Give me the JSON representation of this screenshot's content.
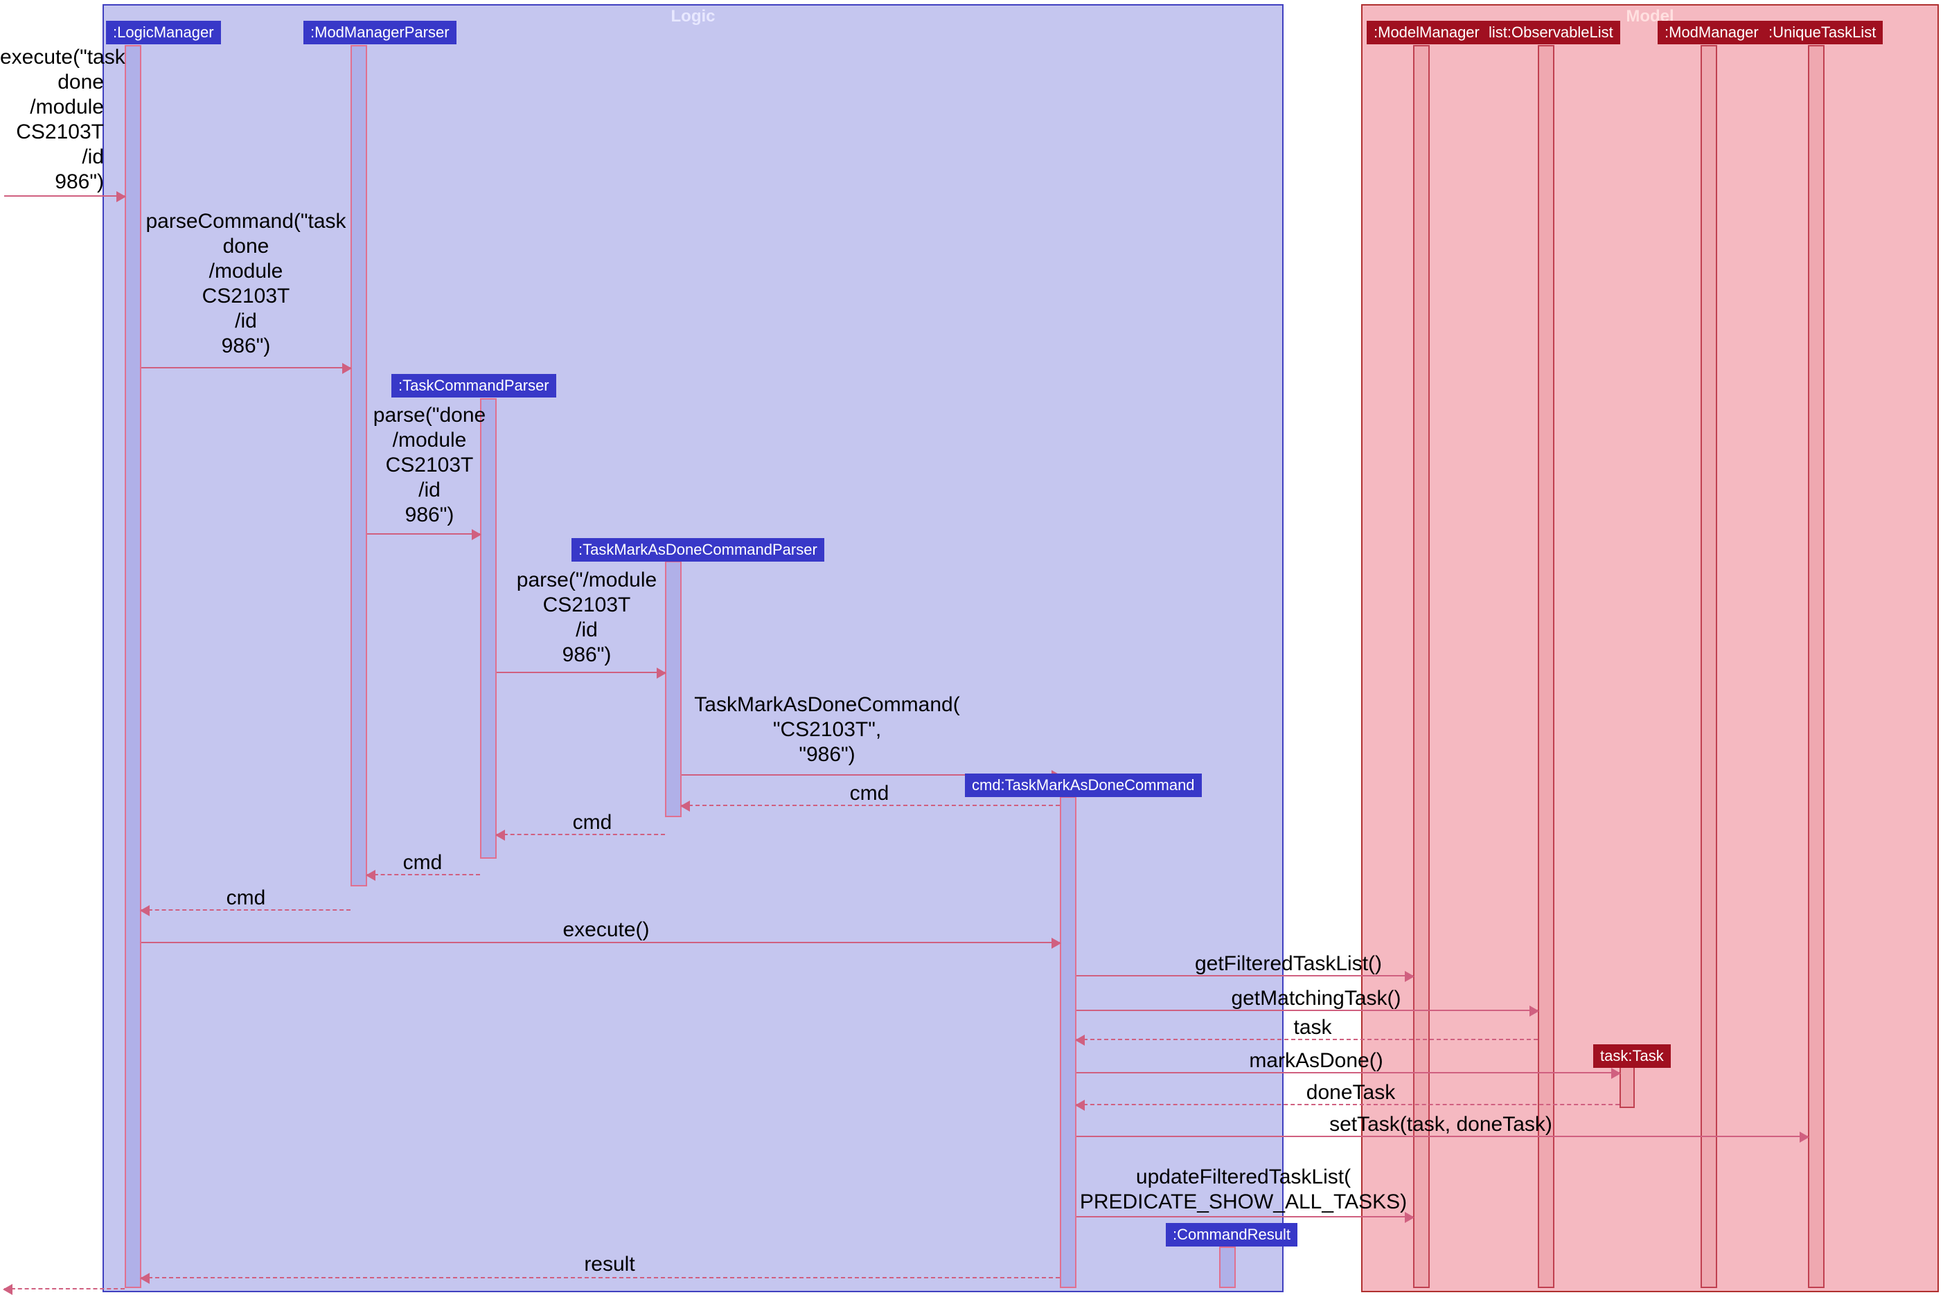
{
  "frames": {
    "logic": {
      "title": "Logic"
    },
    "model": {
      "title": "Model"
    }
  },
  "participants": {
    "logicManager": ":LogicManager",
    "modManagerParser": ":ModManagerParser",
    "taskCommandParser": ":TaskCommandParser",
    "taskMarkAsDoneCommandParser": ":TaskMarkAsDoneCommandParser",
    "cmdTaskMarkAsDoneCommand": "cmd:TaskMarkAsDoneCommand",
    "commandResult": ":CommandResult",
    "modelManager": ":ModelManager",
    "listObservableList": "list:ObservableList",
    "modManagerModel": ":ModManager",
    "uniqueTaskList": ":UniqueTaskList",
    "taskTask": "task:Task"
  },
  "messages": {
    "execute1": "execute(\"task\ndone\n/module\nCS2103T\n/id\n986\")",
    "parseCommand": "parseCommand(\"task\ndone\n/module\nCS2103T\n/id\n986\")",
    "parse1": "parse(\"done\n/module\nCS2103T\n/id\n986\")",
    "parse2": "parse(\"/module\nCS2103T\n/id\n986\")",
    "newCmd": "TaskMarkAsDoneCommand(\n\"CS2103T\",\n\"986\")",
    "cmd1": "cmd",
    "cmd2": "cmd",
    "cmd3": "cmd",
    "cmd4": "cmd",
    "execute2": "execute()",
    "getFilteredTaskList": "getFilteredTaskList()",
    "getMatchingTask": "getMatchingTask()",
    "task": "task",
    "markAsDone": "markAsDone()",
    "doneTask": "doneTask",
    "setTask": "setTask(task, doneTask)",
    "updateFilteredTaskList": "updateFilteredTaskList(\nPREDICATE_SHOW_ALL_TASKS)",
    "result": "result"
  }
}
